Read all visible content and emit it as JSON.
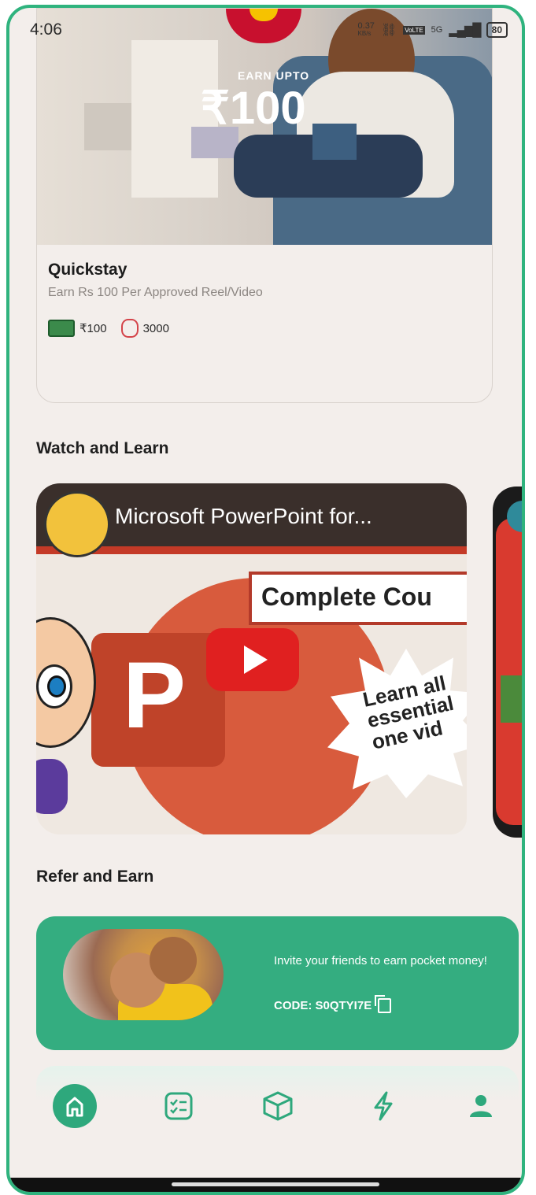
{
  "status_bar": {
    "time": "4:06",
    "net_speed_top": "0.37",
    "net_speed_bottom": "KB/s",
    "signal_label": "5G",
    "battery": "80"
  },
  "hero": {
    "earn_upto": "EARN UPTO",
    "earn_amount": "₹100",
    "title": "Quickstay",
    "subtitle": "Earn Rs 100 Per Approved Reel/Video",
    "reward": "₹100",
    "coins": "3000"
  },
  "watch": {
    "section_title": "Watch and Learn",
    "video_title": "Microsoft PowerPoint for...",
    "banner": "Complete Cou",
    "ppt_letter": "P",
    "starburst": "Learn all\nessential\none vid"
  },
  "refer": {
    "section_title": "Refer and Earn",
    "message": "Invite your friends to earn pocket money!",
    "code": "CODE: S0QTYI7E"
  },
  "nav": {
    "accent": "#2ea87c",
    "items": [
      "home-icon",
      "tasks-icon",
      "box-icon",
      "lightning-icon",
      "profile-icon"
    ]
  }
}
